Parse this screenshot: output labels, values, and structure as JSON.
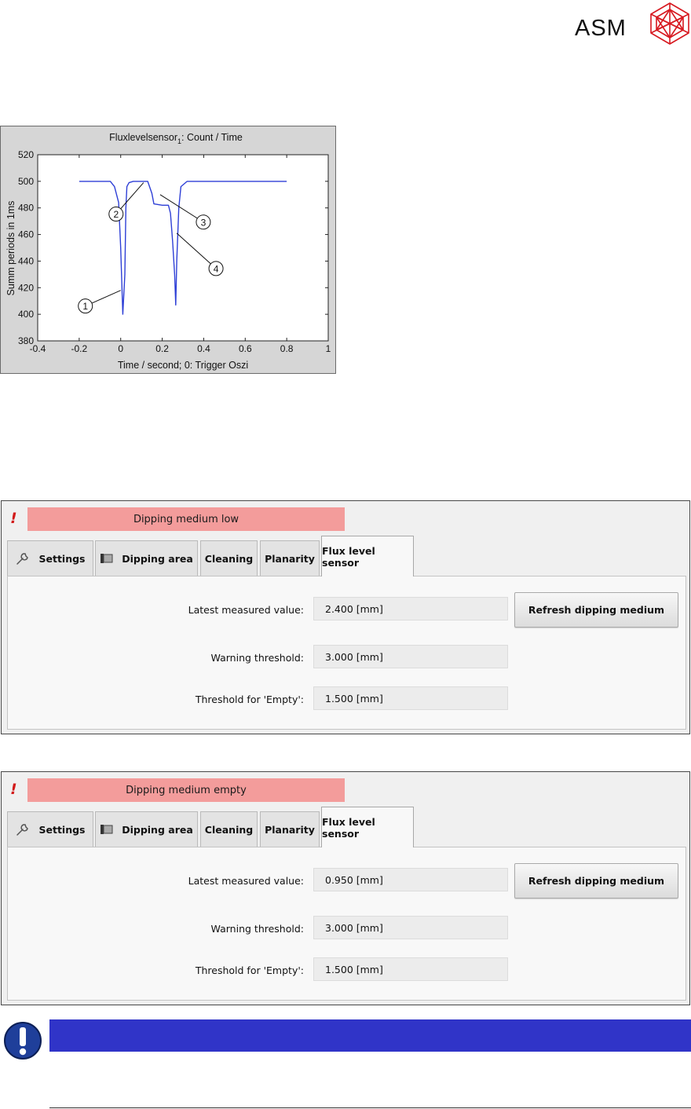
{
  "logo": {
    "text": "ASM",
    "icon": "asm-crystal-logo-icon",
    "color": "#d71920"
  },
  "chart_data": {
    "type": "line",
    "title": "Fluxlevelsensor",
    "title_subscript": "1",
    "title_suffix": ": Count / Time",
    "xlabel": "Time / second; 0: Trigger Oszi",
    "ylabel": "Summ periods in 1ms",
    "xlim": [
      -0.4,
      1
    ],
    "ylim": [
      380,
      520
    ],
    "x_ticks": [
      "-0.4",
      "-0.2",
      "0",
      "0.2",
      "0.4",
      "0.6",
      "0.8",
      "1"
    ],
    "y_ticks": [
      "380",
      "400",
      "420",
      "440",
      "460",
      "480",
      "500",
      "520"
    ],
    "grid": false,
    "series": [
      {
        "color": "#2e3fd6",
        "x": [
          -0.2,
          -0.05,
          -0.03,
          -0.01,
          0.0,
          0.01,
          0.02,
          0.025,
          0.03,
          0.04,
          0.06,
          0.1,
          0.13,
          0.15,
          0.16,
          0.2,
          0.23,
          0.24,
          0.25,
          0.26,
          0.265,
          0.27,
          0.28,
          0.29,
          0.32,
          0.5,
          0.8
        ],
        "y": [
          500,
          500,
          496,
          484,
          450,
          400,
          430,
          480,
          496,
          499,
          500,
          500,
          500,
          491,
          483,
          482,
          482,
          476,
          455,
          430,
          407,
          440,
          480,
          496,
          500,
          500,
          500
        ]
      }
    ],
    "callouts": [
      {
        "label": "1",
        "x": 0.0,
        "y": 418
      },
      {
        "label": "2",
        "x": 0.11,
        "y": 499
      },
      {
        "label": "3",
        "x": 0.19,
        "y": 490
      },
      {
        "label": "4",
        "x": 0.27,
        "y": 461
      }
    ]
  },
  "panels": [
    {
      "alarm_text": "Dipping medium low",
      "tabs": [
        "Settings",
        "Dipping area",
        "Cleaning",
        "Planarity",
        "Flux level sensor"
      ],
      "active_tab": "Flux level sensor",
      "latest_label": "Latest measured value:",
      "latest_value": "2.400 [mm]",
      "warning_label": "Warning threshold:",
      "warning_value": "3.000 [mm]",
      "empty_label": "Threshold for 'Empty':",
      "empty_value": "1.500 [mm]",
      "refresh_button": "Refresh dipping medium"
    },
    {
      "alarm_text": "Dipping medium empty",
      "tabs": [
        "Settings",
        "Dipping area",
        "Cleaning",
        "Planarity",
        "Flux level sensor"
      ],
      "active_tab": "Flux level sensor",
      "latest_label": "Latest measured value:",
      "latest_value": "0.950 [mm]",
      "warning_label": "Warning threshold:",
      "warning_value": "3.000 [mm]",
      "empty_label": "Threshold for 'Empty':",
      "empty_value": "1.500 [mm]",
      "refresh_button": "Refresh dipping medium"
    }
  ],
  "colors": {
    "alarm_bg": "#f39c9b",
    "note_bar": "#3034c8",
    "note_icon": "#1f3f9a"
  }
}
